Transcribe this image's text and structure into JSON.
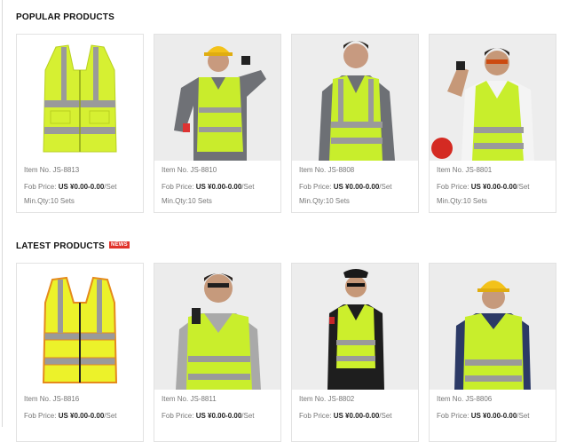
{
  "colors": {
    "accent": "#e0332b",
    "vest": "#d6f032",
    "reflective": "#9a9a9a",
    "photo_bg": "#eeeeee"
  },
  "popular": {
    "title": "POPULAR PRODUCTS",
    "items": [
      {
        "item_no": "Item No. JS-8813",
        "fob_label": "Fob Price:",
        "price": "US ¥0.00-0.00",
        "unit": "/Set",
        "moq": "Min.Qty:10 Sets",
        "image": "vest-icon"
      },
      {
        "item_no": "Item No. JS-8810",
        "fob_label": "Fob Price:",
        "price": "US ¥0.00-0.00",
        "unit": "/Set",
        "moq": "Min.Qty:10 Sets",
        "image": "worker-vest-helmet-icon"
      },
      {
        "item_no": "Item No. JS-8808",
        "fob_label": "Fob Price:",
        "price": "US ¥0.00-0.00",
        "unit": "/Set",
        "moq": "Min.Qty:10 Sets",
        "image": "model-vest-icon"
      },
      {
        "item_no": "Item No. JS-8801",
        "fob_label": "Fob Price:",
        "price": "US ¥0.00-0.00",
        "unit": "/Set",
        "moq": "Min.Qty:10 Sets",
        "image": "model-vest-glasses-icon"
      }
    ]
  },
  "latest": {
    "title": "LATEST PRODUCTS",
    "badge": "NEWS",
    "items": [
      {
        "item_no": "Item No. JS-8816",
        "fob_label": "Fob Price:",
        "price": "US ¥0.00-0.00",
        "unit": "/Set",
        "image": "vest-orange-trim-icon"
      },
      {
        "item_no": "Item No. JS-8811",
        "fob_label": "Fob Price:",
        "price": "US ¥0.00-0.00",
        "unit": "/Set",
        "image": "model-vest-radio-icon"
      },
      {
        "item_no": "Item No. JS-8802",
        "fob_label": "Fob Price:",
        "price": "US ¥0.00-0.00",
        "unit": "/Set",
        "image": "security-vest-cap-icon"
      },
      {
        "item_no": "Item No. JS-8806",
        "fob_label": "Fob Price:",
        "price": "US ¥0.00-0.00",
        "unit": "/Set",
        "image": "worker-vest-hardhat-icon"
      }
    ]
  }
}
